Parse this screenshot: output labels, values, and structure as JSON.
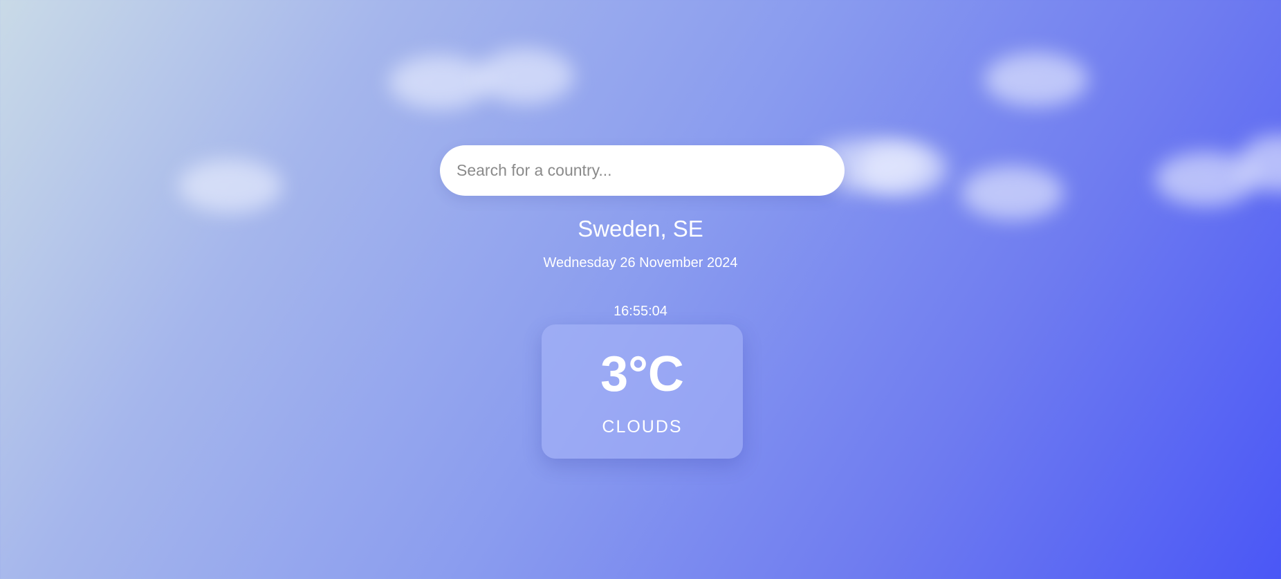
{
  "search": {
    "placeholder": "Search for a country...",
    "value": ""
  },
  "location": "Sweden, SE",
  "date": "Wednesday 26 November 2024",
  "time": "16:55:04",
  "weather": {
    "temperature": "3°C",
    "condition": "CLOUDS"
  },
  "colors": {
    "gradient_start": "#c9dae7",
    "gradient_end": "#4a57f6",
    "text": "#ffffff"
  }
}
